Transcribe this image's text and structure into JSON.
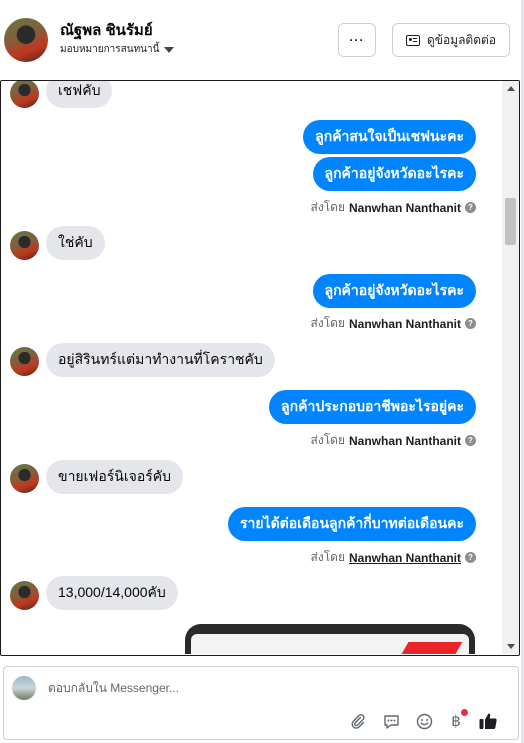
{
  "header": {
    "contact_name": "ณัฐพล ชินรัมย์",
    "assign_label": "มอบหมายการสนทนานี้",
    "more_label": "···",
    "contact_info_label": "ดูข้อมูลติดต่อ"
  },
  "conversation": {
    "messages": [
      {
        "direction": "in",
        "text": "เชฟคับ"
      },
      {
        "direction": "out",
        "text": "ลูกค้าสนใจเป็นเชฟนะคะ"
      },
      {
        "direction": "out",
        "text": "ลูกค้าอยู่จังหวัดอะไรคะ"
      },
      {
        "direction": "in",
        "text": "ใช่คับ"
      },
      {
        "direction": "out",
        "text": "ลูกค้าอยู่จังหวัดอะไรคะ"
      },
      {
        "direction": "in",
        "text": "อยู่สิรินทร์แต่มาทำงานที่โคราชคับ"
      },
      {
        "direction": "out",
        "text": "ลูกค้าประกอบอาชีพอะไรอยู่คะ"
      },
      {
        "direction": "in",
        "text": "ขายเฟอร์นิเจอร์คับ"
      },
      {
        "direction": "out",
        "text": "รายได้ต่อเดือนลูกค้ากี่บาทต่อเดือนคะ"
      },
      {
        "direction": "in",
        "text": "13,000/14,000คับ"
      }
    ],
    "sent_by_prefix": "ส่งโดย",
    "sender_name": "Nanwhan Nanthanit"
  },
  "composer": {
    "placeholder": "ตอบกลับใน Messenger...",
    "baht_symbol": "฿"
  },
  "colors": {
    "outgoing_bubble": "#0084ff",
    "incoming_bubble": "#e4e6eb",
    "notification_dot": "#f02849"
  }
}
